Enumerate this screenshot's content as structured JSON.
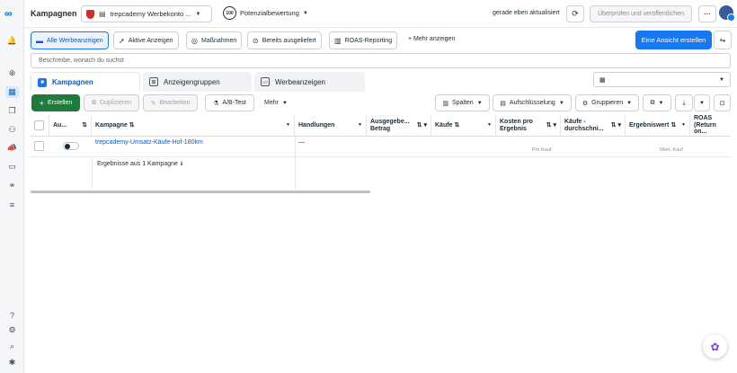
{
  "rail": {
    "logo": "∞",
    "top_icons": [
      "bell-icon",
      "plus-circle-icon",
      "grid-table-icon",
      "pages-icon",
      "people-icon",
      "megaphone-icon",
      "card-icon",
      "network-icon",
      "menu-icon"
    ],
    "bottom_icons": [
      "help-icon",
      "settings-icon",
      "search-icon",
      "bug-icon"
    ]
  },
  "topbar": {
    "title": "Kampagnen",
    "account_name": "trepcademy Werbekonto ...",
    "score_badge": "100",
    "score_label": "Potenzialbewertung",
    "status": "gerade eben aktualisiert",
    "review_button": "Überprüfen und veröffentlichen",
    "more_button": "···"
  },
  "filters": {
    "items": [
      {
        "label": "Alle Werbeanzeigen",
        "icon": "folder-icon",
        "selected": true
      },
      {
        "label": "Aktive Anzeigen",
        "icon": "send-icon",
        "selected": false
      },
      {
        "label": "Maßnahmen",
        "icon": "target-icon",
        "selected": false
      },
      {
        "label": "Bereits ausgeliefert",
        "icon": "check-icon",
        "selected": false
      },
      {
        "label": "ROAS-Reporting",
        "icon": "chart-icon",
        "selected": false
      }
    ],
    "more": "+  Mehr anzeigen",
    "create_view": "Eine Ansicht erstellen"
  },
  "search": {
    "placeholder": "Beschreibe, wonach du suchst"
  },
  "tabs": [
    {
      "label": "Kampagnen",
      "active": true
    },
    {
      "label": "Anzeigengruppen",
      "active": false
    },
    {
      "label": "Werbeanzeigen",
      "active": false
    }
  ],
  "toolbar": {
    "create": "Erstellen",
    "duplicate": "Duplizieren",
    "edit": "Bearbeiten",
    "ab_test": "A/B-Test",
    "more": "Mehr",
    "columns": "Spalten",
    "breakdown": "Aufschlüsselung",
    "group": "Gruppieren"
  },
  "table": {
    "headers": {
      "status": "Au...",
      "campaign": "Kampagne",
      "actions": "Handlungen",
      "spent": "Ausgegebe... Betrag",
      "purchases": "Käufe",
      "cost": "Kosten pro Ergebnis",
      "avg_purchase": "Käufe - durchschni...",
      "result_value": "Ergebniswert",
      "roas": "ROAS (Return on..."
    },
    "row": {
      "campaign": "trepcademy-Umsatz-Käufe-Hof-180km",
      "actions": "—",
      "cost_sub": "Pro Kauf",
      "result_sub": "Wert, Kauf"
    },
    "summary": "Ergebnisse aus 1 Kampagne"
  }
}
